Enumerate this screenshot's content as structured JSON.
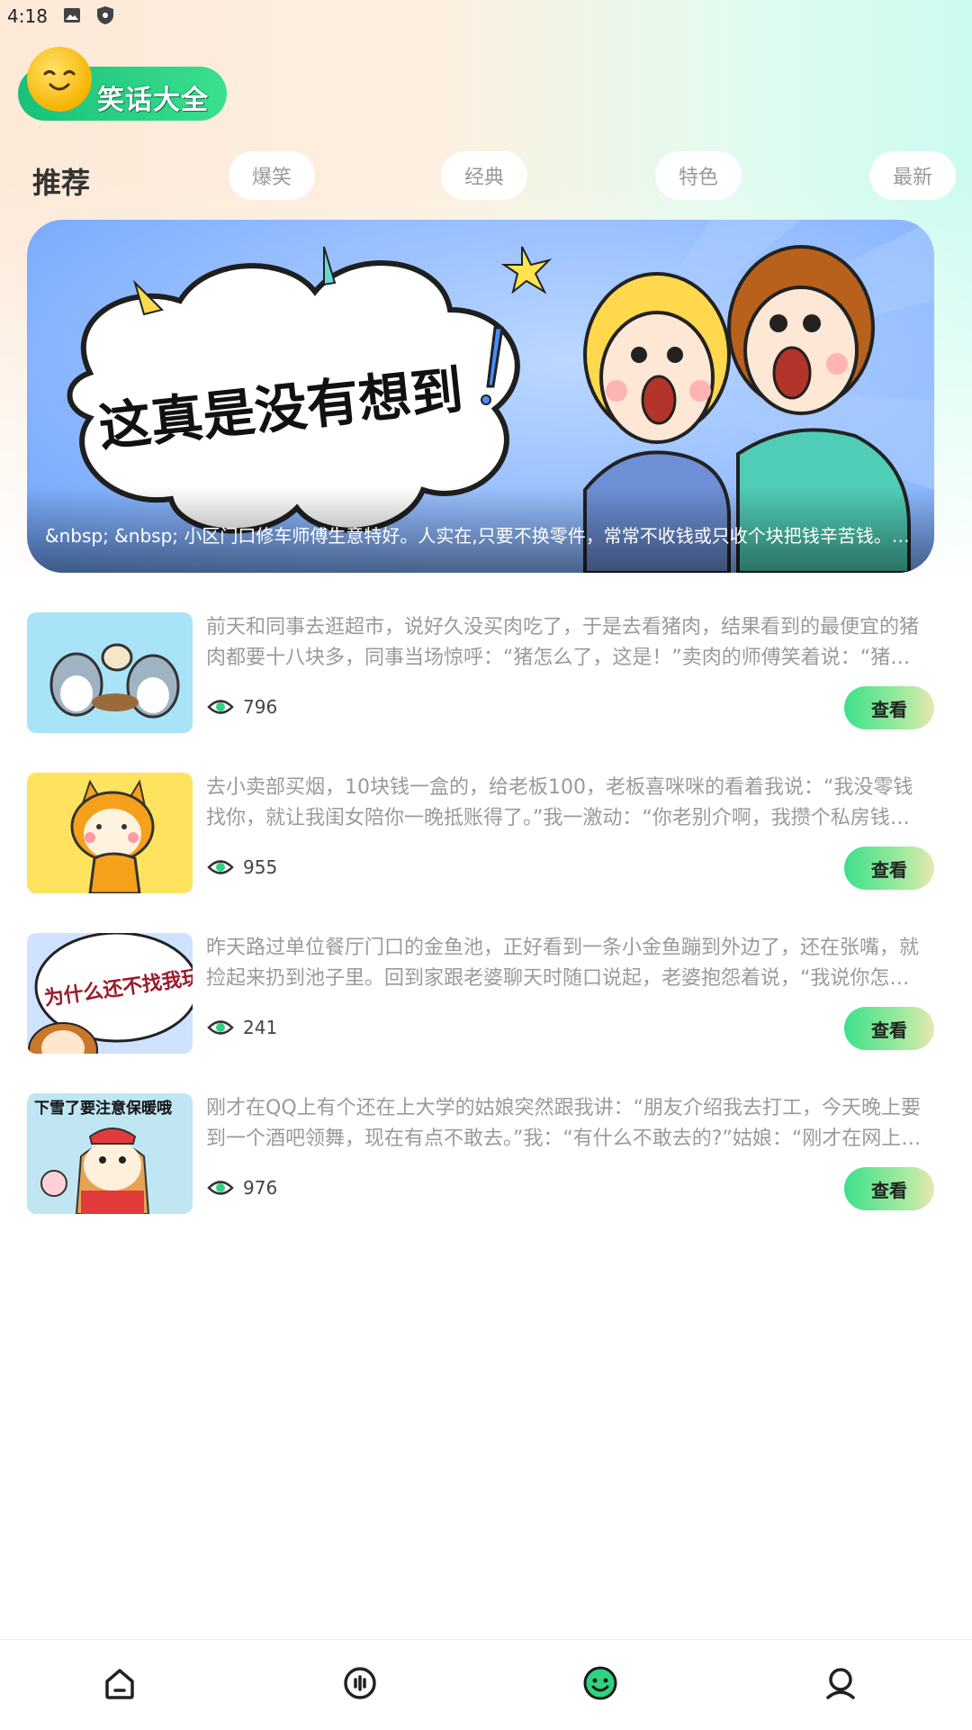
{
  "status_bar": {
    "time": "4:18",
    "icons": [
      "image-icon",
      "shield-icon"
    ]
  },
  "logo": {
    "text": "笑话大全",
    "icon": "smiley-face-icon"
  },
  "tabs": {
    "active": "推荐",
    "items": [
      {
        "label": "爆笑"
      },
      {
        "label": "经典"
      },
      {
        "label": "特色"
      },
      {
        "label": "最新"
      }
    ]
  },
  "banner": {
    "headline": "这真是没有想到",
    "caption": "&nbsp; &nbsp; 小区门口修车师傅生意特好。人实在,只要不换零件，常常不收钱或只收个块把钱辛苦钱。人都夸他，他说：“"
  },
  "jokes": [
    {
      "text": "前天和同事去逛超市，说好久没买肉吃了，于是去看猪肉，结果看到的最便宜的猪肉都要十八块多，同事当场惊呼：“猪怎么了，这是！”卖肉的师傅笑着说：“猪没怎么，是钱怎么了！”",
      "views": "796",
      "button": "查看"
    },
    {
      "text": "去小卖部买烟，10块钱一盒的，给老板100，老板喜咪咪的看着我说：“我没零钱找你，就让我闺女陪你一晚抵账得了。”我一激动：“你老别介啊，我攒个私房钱容易吗？”",
      "views": "955",
      "button": "查看"
    },
    {
      "text": "昨天路过单位餐厅门口的金鱼池，正好看到一条小金鱼蹦到外边了，还在张嘴，就捡起来扔到池子里。回到家跟老婆聊天时随口说起，老婆抱怨着说，“我说你怎么这么傻”",
      "views": "241",
      "button": "查看"
    },
    {
      "text": "刚才在QQ上有个还在上大学的姑娘突然跟我讲：“朋友介绍我去打工，今天晚上要到一个酒吧领舞，现在有点不敢去。”我：“有什么不敢去的?”姑娘：“刚才在网上查了一下”",
      "views": "976",
      "button": "查看"
    }
  ],
  "thumbnails": [
    {
      "caption": ""
    },
    {
      "caption": ""
    },
    {
      "caption": "为什么还不找我玩?"
    },
    {
      "caption": "下雪了要注意保暖哦"
    }
  ],
  "bottom_nav": [
    {
      "name": "home",
      "icon": "home-icon"
    },
    {
      "name": "audio",
      "icon": "audio-bars-icon"
    },
    {
      "name": "jokes",
      "icon": "smiley-icon",
      "active": true
    },
    {
      "name": "profile",
      "icon": "user-icon"
    }
  ],
  "colors": {
    "accent": "#2fd37f",
    "tab_text": "#9a9a9a",
    "body_text": "#9a9a9a"
  }
}
